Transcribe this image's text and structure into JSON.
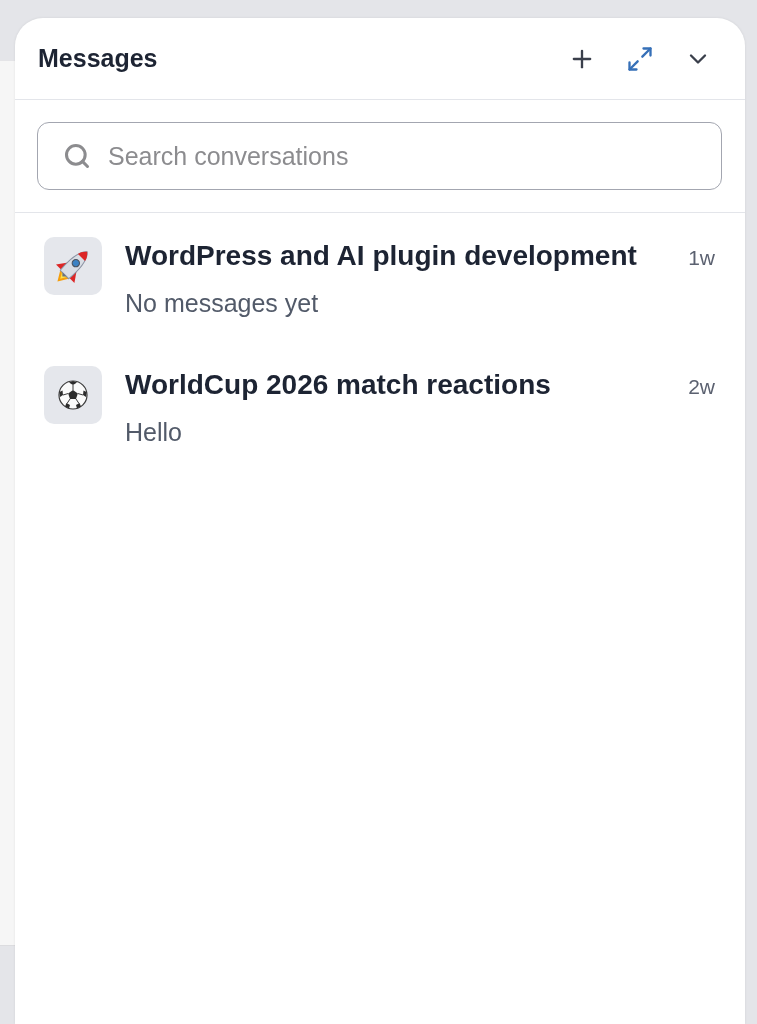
{
  "panel": {
    "title": "Messages"
  },
  "search": {
    "placeholder": "Search conversations"
  },
  "conversations": [
    {
      "kind": "rocket",
      "title": "WordPress and AI plugin development",
      "preview": "No messages yet",
      "time": "1w"
    },
    {
      "kind": "ball",
      "title": "WorldCup 2026 match reactions",
      "preview": "Hello",
      "time": "2w"
    }
  ]
}
